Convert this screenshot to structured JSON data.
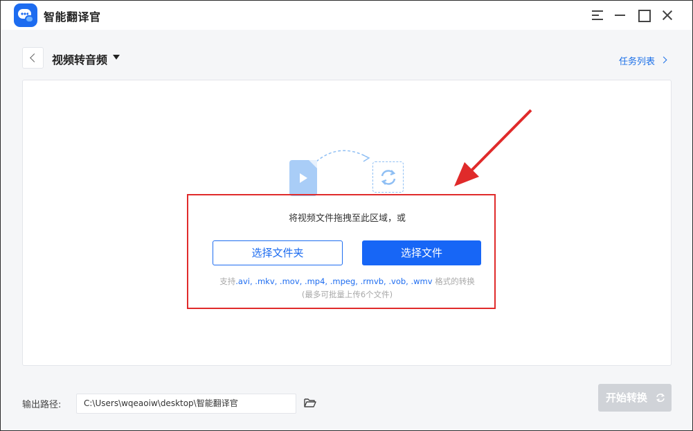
{
  "app": {
    "title": "智能翻译官"
  },
  "header": {
    "mode_title": "视频转音频",
    "task_list_label": "任务列表"
  },
  "drop_zone": {
    "hint": "将视频文件拖拽至此区域，或",
    "choose_folder_label": "选择文件夹",
    "choose_file_label": "选择文件",
    "formats_prefix": "支持",
    "formats_list": ".avi, .mkv, .mov, .mp4, .mpeg, .rmvb, .vob, .wmv",
    "formats_suffix": " 格式的转换",
    "limit_note": "(最多可批量上传6个文件)"
  },
  "footer": {
    "output_label": "输出路径:",
    "output_path": "C:\\Users\\wqeaoiw\\desktop\\智能翻译官",
    "start_label": "开始转换"
  },
  "icons": {
    "logo": "chat-bubble-icon",
    "menu": "menu-icon",
    "minimize": "minimize-icon",
    "maximize": "maximize-icon",
    "close": "close-icon",
    "back": "chevron-left-icon",
    "caret": "caret-down-icon",
    "chevron": "chevron-right-icon",
    "folder": "folder-open-icon",
    "refresh": "refresh-icon"
  },
  "colors": {
    "accent": "#1766f6",
    "annotation": "#e02a2a",
    "disabled": "#d0d3d8"
  }
}
